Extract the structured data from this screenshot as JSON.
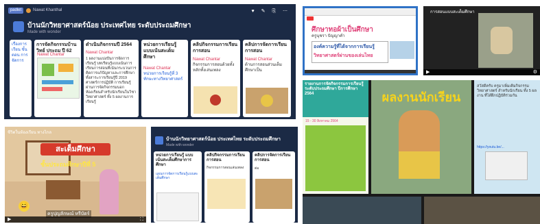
{
  "padlet_top": {
    "logo": "padlet",
    "author": "Nawat Khanthal",
    "title": "บ้านนักวิทยาศาสตร์น้อย ประเทศไทย ระดับประถมศึกษา",
    "subtitle": "Made with wonder",
    "columns": [
      {
        "header": "การจัดกิจกรรมบ้านวิทย์ ประถม ปี 62",
        "note": "Nawat Chantar"
      },
      {
        "header": "ดำเนินกิจกรรมปี 2564",
        "note": "Nawat Chantar",
        "body": "1 ผลงานแบ่งปันการจัดการเรียนรู้ บทเรียนรู้แบบเน้นการเรียนการสอนที่เน้นกระบวนการคิดการแก้ปัญหาและการศึกษาทั้งสาระการเรียนรู้ปี 2019 ศาสตร์การปฏิบัติ การเรียนรู้ ผ่านการจัดกิจกรรมนอกห้องเรียนสำหรับนักเรียนในวิชาวิทยาศาสตร์ ทั้ง 5 ผลงานการเรียนรู้"
      },
      {
        "header": "หน่วยการเรียนรู้ แบบเน้นสะเต็มศึกษา",
        "note": "Nawat Chantar",
        "body": "หน่วยการเรียนรู้ที่ 3 ทักษะทางวิทยาศาสตร์"
      },
      {
        "header": "คลิปกิจกรรมการเรียนการสอน",
        "note": "Nawat Chantar",
        "body": "กิจกรรมการสอนด้วยทั้งหลักทั้งเล่นเพลง"
      },
      {
        "header": "คลิปการจัดการเรียนการสอน",
        "note": "Nawat Chantar",
        "body": "ด้านการสอนส่วนเต็มศึกษาเป็น"
      }
    ]
  },
  "top_middle_slide": {
    "heading": "ศึกษาทอผ้าเป็นศึกษา",
    "subheading": "ครูนุชรา ปัญญาคำ",
    "box_title": "องค์ความรู้ที่ได้จากการเรียนรู้",
    "box_text": "วิทยาศาสตร์ผ่านของเล่นไทย"
  },
  "top_right_video": {
    "title": "การสอนแบบสะเต็มศึกษา"
  },
  "bottom_left_video": {
    "banner": "สะเต็มศึกษา",
    "subtitle": "ชั้นประถมศึกษาปีที่ 5",
    "caption": "ครูปุญลักษณ์ หรีบัตร์",
    "top_label": "ชีวิตในห้องเรียน ทางไกล"
  },
  "padlet_bottom": {
    "title": "บ้านนักวิทยาศาสตร์น้อย ประเทศไทย ระดับประถมศึกษา",
    "subtitle": "Made with wonder",
    "columns": [
      {
        "header": "หน่วยการเรียนรู้ แบบเน้นสะเต็มศึกษาการศึกษา",
        "body": "แผนการจัดการเรียนรู้แบบสะเต็มศึกษา"
      },
      {
        "header": "คลิปกิจกรรมการเรียนการสอน",
        "body": "กิจกรรมการสอนเล่นเพลง"
      },
      {
        "header": "คลิปการจัดการเรียนการสอน",
        "body": "ต่อ"
      }
    ]
  },
  "bottom_right_collage": {
    "poster_title": "รายงานการจัดกิจกรรมการเรียนรู้ ระดับประถมศึกษา ปีการศึกษา 2564",
    "poster_date": "15 - 30 สิงหาคม 2564",
    "photo_title": "ผลงานนักเรียน",
    "chat_text": "สวัสดีครับ ครูมาเพิ่มเติมกิจกรรมวิทยาศาสตร์ สำหรับนักเรียน ทั้ง 5 ผลงาน ที่ได้ฝึกปฏิบัติร่วมกัน",
    "chat_link": "https://youtu.be/..."
  },
  "colors": {
    "padlet_bg": "#1b2a45",
    "slide_green": "#3a8f3a",
    "poster_green": "#8cc63f",
    "poster_teal": "#2fa89a",
    "photo_yellow": "#f6d31c",
    "chat_bg": "#cfe6f2"
  }
}
